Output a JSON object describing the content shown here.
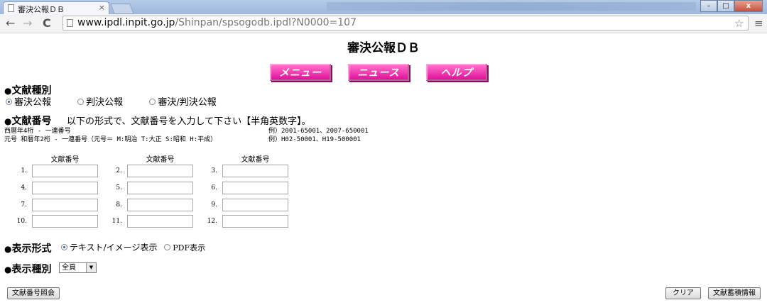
{
  "browser": {
    "tab_title": "審決公報ＤＢ",
    "tab_close": "×",
    "url_host": "www.ipdl.inpit.go.jp",
    "url_path": "/Shinpan/spsogodb.ipdl?N0000=107",
    "win_min": "–",
    "win_max": "□",
    "win_close": "x",
    "back": "←",
    "forward": "→",
    "reload": "C",
    "star": "☆",
    "menu": "≡"
  },
  "page": {
    "title": "審決公報ＤＢ",
    "nav_buttons": [
      "メニュー",
      "ニュース",
      "ヘルプ"
    ],
    "doc_type": {
      "bullet": "●",
      "label": "文献種別",
      "options": [
        "審決公報",
        "判決公報",
        "審決/判決公報"
      ],
      "selected": "審決公報"
    },
    "doc_number": {
      "bullet": "●",
      "label": "文献番号",
      "instruction": "以下の形式で、文献番号を入力して下さい【半角英数字】。",
      "format_line1": "西暦年4桁 - 一連番号",
      "format_example1": "例）2001-65001、2007-650001",
      "format_line2": "元号 和暦年2桁 - 一連番号（元号＝ M:明治 T:大正 S:昭和 H:平成）",
      "format_example2": "例）H02-50001、H19-500001",
      "column_header": "文献番号",
      "fields": [
        "1.",
        "2.",
        "3.",
        "4.",
        "5.",
        "6.",
        "7.",
        "8.",
        "9.",
        "10.",
        "11.",
        "12."
      ]
    },
    "display_format": {
      "bullet": "●",
      "label": "表示形式",
      "options": [
        "テキスト/イメージ表示",
        "PDF表示"
      ],
      "selected": "テキスト/イメージ表示"
    },
    "display_type": {
      "bullet": "●",
      "label": "表示種別",
      "selected": "全頁",
      "arrow": "▼"
    },
    "buttons": {
      "lookup": "文献番号照会",
      "clear": "クリア",
      "accumulate": "文献蓄積情報"
    }
  },
  "colors": {
    "nav_pink": "#e0119b",
    "radio_selected": "#2b5fb8"
  }
}
